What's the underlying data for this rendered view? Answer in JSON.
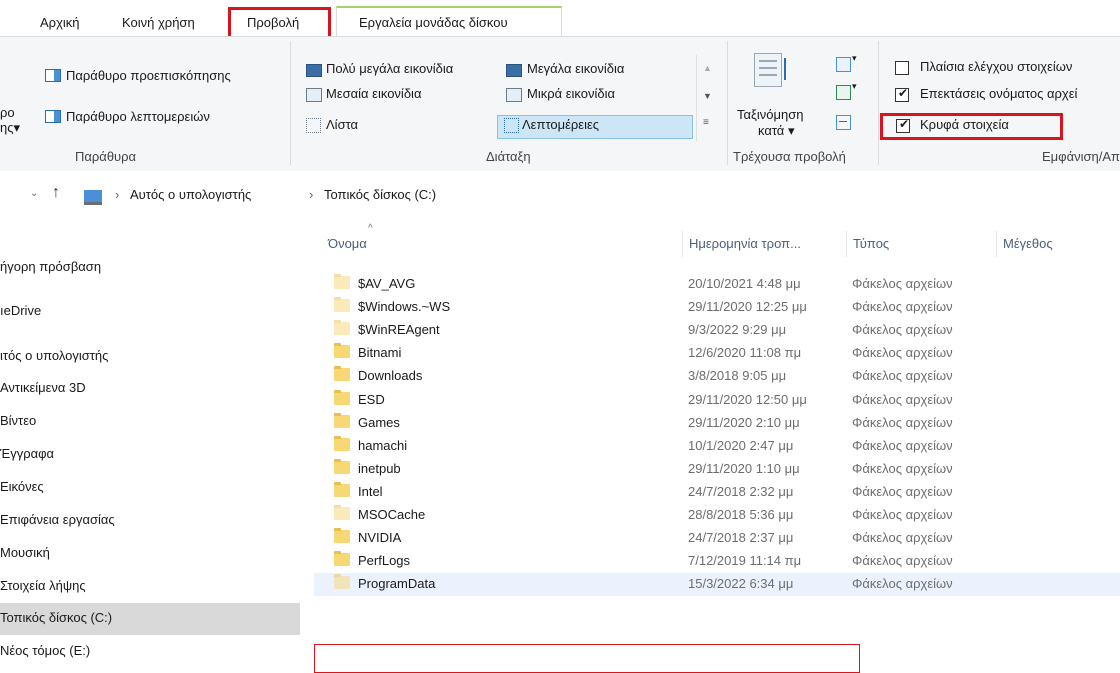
{
  "tabs": {
    "home": "Αρχική",
    "share": "Κοινή χρήση",
    "view": "Προβολή",
    "drive_tools": "Εργαλεία μονάδας δίσκου"
  },
  "ribbon": {
    "panes": {
      "nav_pane_partial": "ρο",
      "nav_pane_partial2": "ης",
      "preview_pane": "Παράθυρο προεπισκόπησης",
      "details_pane": "Παράθυρο λεπτομερειών",
      "group_label": "Παράθυρα"
    },
    "layout": {
      "extra_large_icons": "Πολύ μεγάλα εικονίδια",
      "large_icons": "Μεγάλα εικονίδια",
      "medium_icons": "Μεσαία εικονίδια",
      "small_icons": "Μικρά εικονίδια",
      "list": "Λίστα",
      "details": "Λεπτομέρειες",
      "group_label": "Διάταξη"
    },
    "current_view": {
      "sort_by_line1": "Ταξινόμηση",
      "sort_by_line2": "κατά",
      "group_label": "Τρέχουσα προβολή"
    },
    "show_hide": {
      "item_check_boxes": "Πλαίσια ελέγχου στοιχείων",
      "file_name_extensions": "Επεκτάσεις ονόματος αρχεί",
      "hidden_items": "Κρυφά στοιχεία",
      "item_check_boxes_checked": false,
      "file_name_extensions_checked": true,
      "hidden_items_checked": true,
      "group_label": "Εμφάνιση/Απ"
    }
  },
  "address": {
    "this_pc": "Αυτός ο υπολογιστής",
    "local_disk": "Τοπικός δίσκος (C:)",
    "separator": "›"
  },
  "nav": {
    "items": [
      "ήγορη πρόσβαση",
      "ıeDrive",
      "ιτός ο υπολογιστής",
      "Αντικείμενα 3D",
      "Βίντεο",
      "Έγγραφα",
      "Εικόνες",
      "Επιφάνεια εργασίας",
      "Μουσική",
      "Στοιχεία λήψης",
      "Τοπικός δίσκος (C:)",
      "Νέος τόμος (E:)"
    ],
    "selected_index": 10
  },
  "columns": {
    "name": "Όνομα",
    "date": "Ημερομηνία τροπ...",
    "type": "Τύπος",
    "size": "Μέγεθος"
  },
  "files": [
    {
      "name": "$AV_AVG",
      "date": "20/10/2021 4:48 μμ",
      "type": "Φάκελος αρχείων",
      "hidden": true
    },
    {
      "name": "$Windows.~WS",
      "date": "29/11/2020 12:25 μμ",
      "type": "Φάκελος αρχείων",
      "hidden": true
    },
    {
      "name": "$WinREAgent",
      "date": "9/3/2022 9:29 μμ",
      "type": "Φάκελος αρχείων",
      "hidden": true
    },
    {
      "name": "Bitnami",
      "date": "12/6/2020 11:08 πμ",
      "type": "Φάκελος αρχείων",
      "hidden": false
    },
    {
      "name": "Downloads",
      "date": "3/8/2018 9:05 μμ",
      "type": "Φάκελος αρχείων",
      "hidden": false
    },
    {
      "name": "ESD",
      "date": "29/11/2020 12:50 μμ",
      "type": "Φάκελος αρχείων",
      "hidden": false
    },
    {
      "name": "Games",
      "date": "29/11/2020 2:10 μμ",
      "type": "Φάκελος αρχείων",
      "hidden": false
    },
    {
      "name": "hamachi",
      "date": "10/1/2020 2:47 μμ",
      "type": "Φάκελος αρχείων",
      "hidden": false
    },
    {
      "name": "inetpub",
      "date": "29/11/2020 1:10 μμ",
      "type": "Φάκελος αρχείων",
      "hidden": false
    },
    {
      "name": "Intel",
      "date": "24/7/2018 2:32 μμ",
      "type": "Φάκελος αρχείων",
      "hidden": false
    },
    {
      "name": "MSOCache",
      "date": "28/8/2018 5:36 μμ",
      "type": "Φάκελος αρχείων",
      "hidden": true
    },
    {
      "name": "NVIDIA",
      "date": "24/7/2018 2:37 μμ",
      "type": "Φάκελος αρχείων",
      "hidden": false
    },
    {
      "name": "PerfLogs",
      "date": "7/12/2019 11:14 πμ",
      "type": "Φάκελος αρχείων",
      "hidden": false
    },
    {
      "name": "ProgramData",
      "date": "15/3/2022 6:34 μμ",
      "type": "Φάκελος αρχείων",
      "hidden": true
    }
  ],
  "colors": {
    "highlight_red": "#d9141c",
    "selection_blue": "#cde6f7",
    "folder_yellow": "#f8d775"
  }
}
